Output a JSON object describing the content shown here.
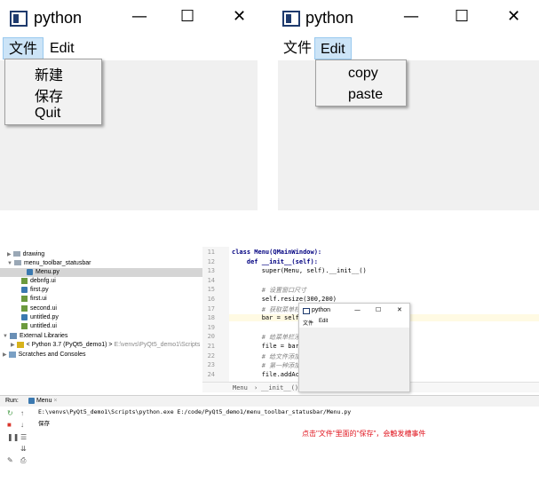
{
  "window_left": {
    "title": "python",
    "controls": {
      "minimize": "—",
      "maximize": "☐",
      "close": "✕"
    },
    "menus": [
      "文件",
      "Edit"
    ],
    "dropdown": [
      "新建",
      "保存",
      "Quit"
    ]
  },
  "window_right": {
    "title": "python",
    "controls": {
      "minimize": "—",
      "maximize": "☐",
      "close": "✕"
    },
    "menus": [
      "文件",
      "Edit"
    ],
    "dropdown": [
      "copy",
      "paste"
    ]
  },
  "ide": {
    "tree": [
      {
        "label": "drawing",
        "kind": "folder",
        "arrow": "▶"
      },
      {
        "label": "menu_toolbar_statusbar",
        "kind": "folder",
        "arrow": "▼"
      },
      {
        "label": "Menu.py",
        "kind": "py",
        "selected": true
      },
      {
        "label": "debnfg.ui",
        "kind": "ui"
      },
      {
        "label": "first.py",
        "kind": "py"
      },
      {
        "label": "first.ui",
        "kind": "ui"
      },
      {
        "label": "second.ui",
        "kind": "ui"
      },
      {
        "label": "untitled.py",
        "kind": "py"
      },
      {
        "label": "untitled.ui",
        "kind": "ui"
      },
      {
        "label": "External Libraries",
        "kind": "lib",
        "arrow": "▼"
      },
      {
        "label": "< Python 3.7 (PyQt5_demo1) >",
        "path": "E:\\venvs\\PyQt5_demo1\\Scripts",
        "kind": "lib",
        "arrow": "▶"
      },
      {
        "label": "Scratches and Consoles",
        "kind": "lib",
        "arrow": "▶"
      }
    ],
    "code_lines": [
      {
        "n": "11",
        "text": "class Menu(QMainWindow):"
      },
      {
        "n": "12",
        "text": "    def __init__(self):"
      },
      {
        "n": "13",
        "text": "        super(Menu, self).__init__()"
      },
      {
        "n": "14",
        "text": ""
      },
      {
        "n": "15",
        "text": "        # 设置窗口尺寸"
      },
      {
        "n": "16",
        "text": "        self.resize(300,200)"
      },
      {
        "n": "17",
        "text": "        # 获取菜单栏"
      },
      {
        "n": "18",
        "text": "        bar = self"
      },
      {
        "n": "19",
        "text": ""
      },
      {
        "n": "20",
        "text": "        # 给菜单栏添"
      },
      {
        "n": "21",
        "text": "        file = bar"
      },
      {
        "n": "22",
        "text": "        # 给文件添加"
      },
      {
        "n": "23",
        "text": "        # 第一种添加"
      },
      {
        "n": "24",
        "text": "        file.addAc"
      }
    ],
    "breadcrumb": [
      "Menu",
      "›",
      "__init__()"
    ],
    "mini_window": {
      "title": "python",
      "menus": [
        "文件",
        "Edit"
      ],
      "controls": {
        "minimize": "—",
        "maximize": "☐",
        "close": "✕"
      }
    },
    "run": {
      "label": "Run:",
      "tab": "Menu",
      "tab_close": "×",
      "command": "E:\\venvs\\PyQt5_demo1\\Scripts\\python.exe E:/code/PyQt5_demo1/menu_toolbar_statusbar/Menu.py",
      "output": "保存",
      "note": "点击\"文件\"里面的\"保存\"，会触发槽事件"
    }
  },
  "colors": {
    "menu_active_bg": "#cce4f7",
    "client_bg": "#f0f0f0",
    "note_red": "#e0141e"
  }
}
